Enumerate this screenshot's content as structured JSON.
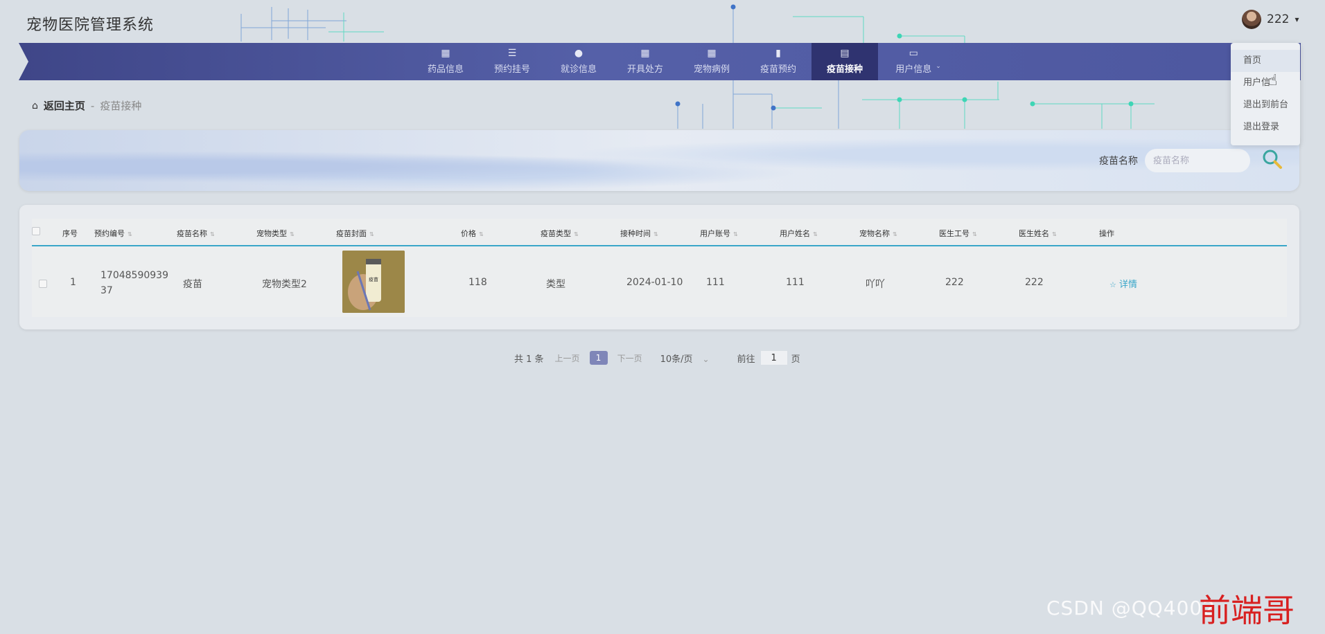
{
  "app_title": "宠物医院管理系统",
  "user": {
    "name": "222",
    "caret": "▾"
  },
  "dropdown": {
    "items": [
      "首页",
      "用户信",
      "退出到前台",
      "退出登录"
    ]
  },
  "nav": {
    "items": [
      "药品信息",
      "预约挂号",
      "就诊信息",
      "开具处方",
      "宠物病例",
      "疫苗预约",
      "疫苗接种",
      "用户信息"
    ],
    "active": "疫苗接种"
  },
  "breadcrumb": {
    "home": "返回主页",
    "sep": "-",
    "current": "疫苗接种"
  },
  "search": {
    "label": "疫苗名称",
    "placeholder": "疫苗名称"
  },
  "table": {
    "headers": [
      "序号",
      "预约编号",
      "疫苗名称",
      "宠物类型",
      "疫苗封面",
      "价格",
      "疫苗类型",
      "接种时间",
      "用户账号",
      "用户姓名",
      "宠物名称",
      "医生工号",
      "医生姓名",
      "操作"
    ],
    "rows": [
      {
        "index": "1",
        "appointment_no_line1": "17048590939",
        "appointment_no_line2": "37",
        "vaccine_name": "疫苗",
        "pet_type": "宠物类型2",
        "price": "118",
        "vaccine_type": "类型",
        "time": "2024-01-10",
        "user_account": "111",
        "user_name": "111",
        "pet_name": "吖吖",
        "doctor_no": "222",
        "doctor_name": "222",
        "action": "详情",
        "cover_label": "疫苗"
      }
    ]
  },
  "pager": {
    "total": "共 1 条",
    "prev": "上一页",
    "page": "1",
    "next": "下一页",
    "size": "10条/页",
    "goto_label": "前往",
    "goto_value": "1",
    "page_unit": "页"
  },
  "watermark": {
    "text": "CSDN @QQ4002",
    "red_text": "前端哥"
  },
  "colors": {
    "nav_bg": "#4d579f",
    "nav_active": "#2f3370",
    "accent": "#39a6c9",
    "page_btn": "#7f86b8"
  }
}
